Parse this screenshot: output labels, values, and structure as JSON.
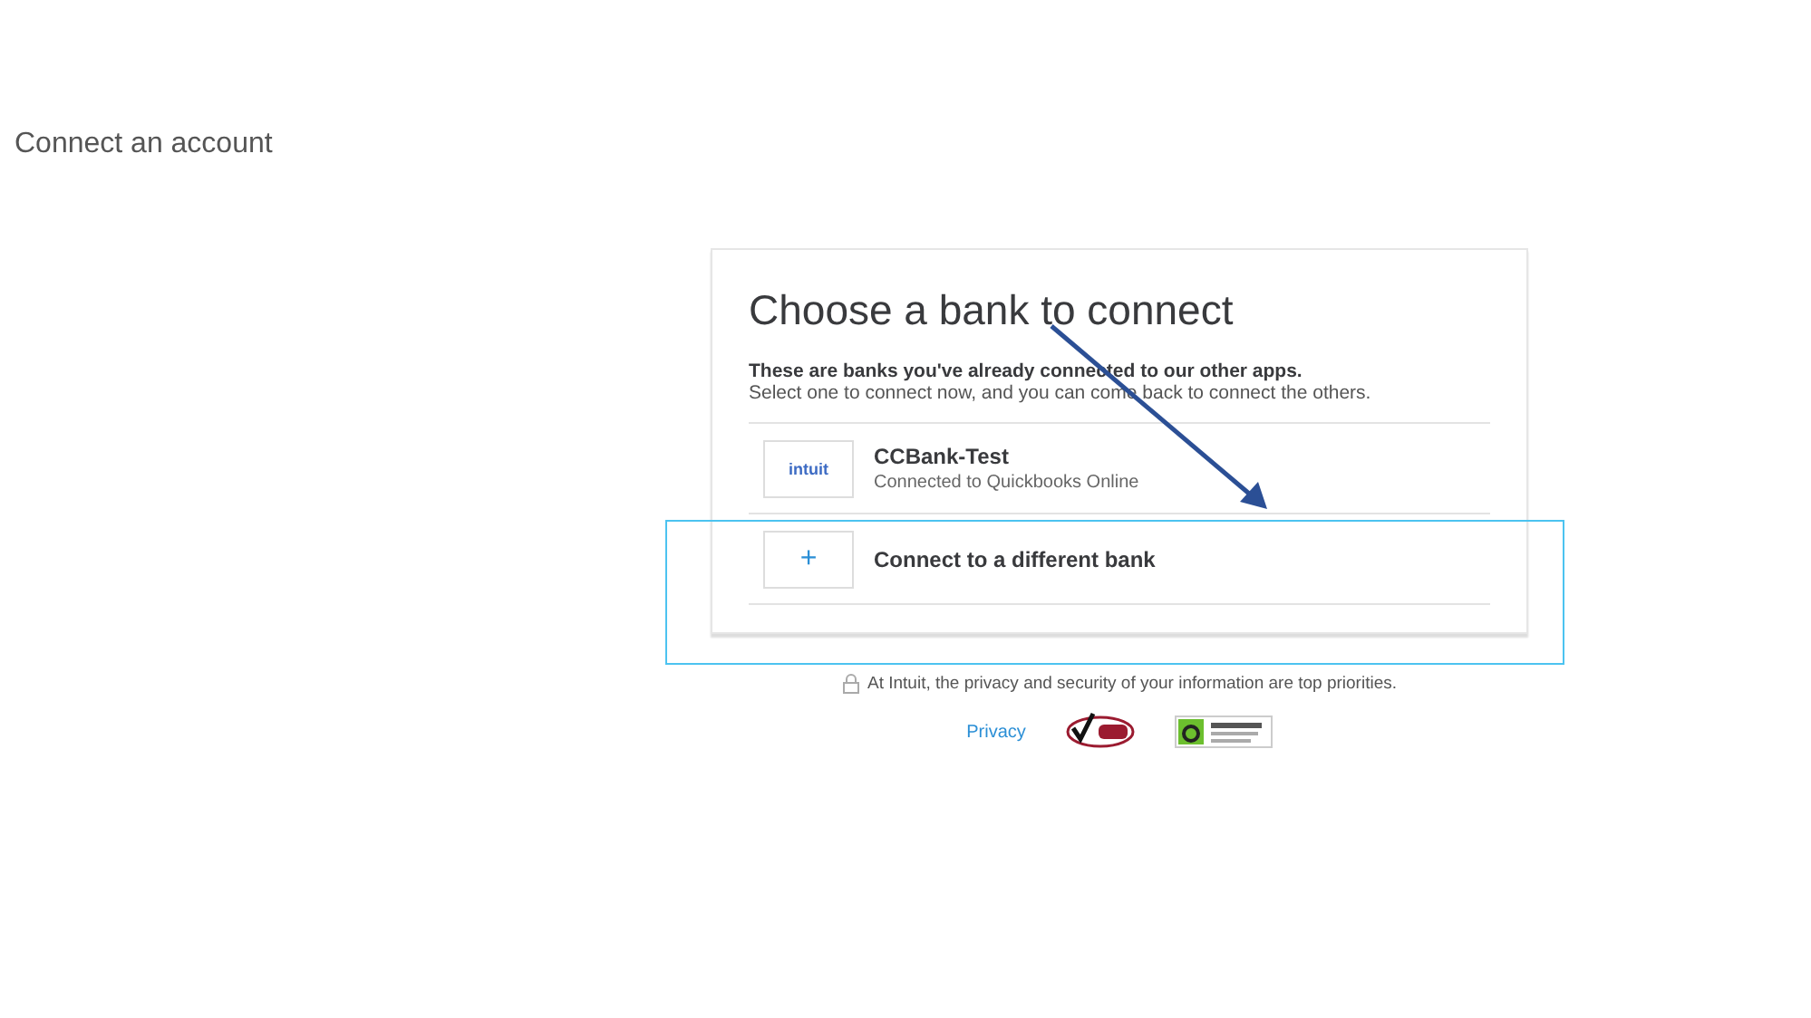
{
  "page_title": "Connect an account",
  "card": {
    "heading": "Choose a bank to connect",
    "intro_bold": "These are banks you've already connected to our other apps.",
    "intro": "Select one to connect now, and you can come back to connect the others.",
    "options": [
      {
        "kind": "bank",
        "logo_text": "intuit",
        "name": "CCBank-Test",
        "status": "Connected to Quickbooks Online"
      },
      {
        "kind": "add",
        "symbol": "+",
        "name": "Connect to a different bank"
      }
    ]
  },
  "privacy_note": "At Intuit, the privacy and security of your information are top priorities.",
  "footer_link": "Privacy"
}
